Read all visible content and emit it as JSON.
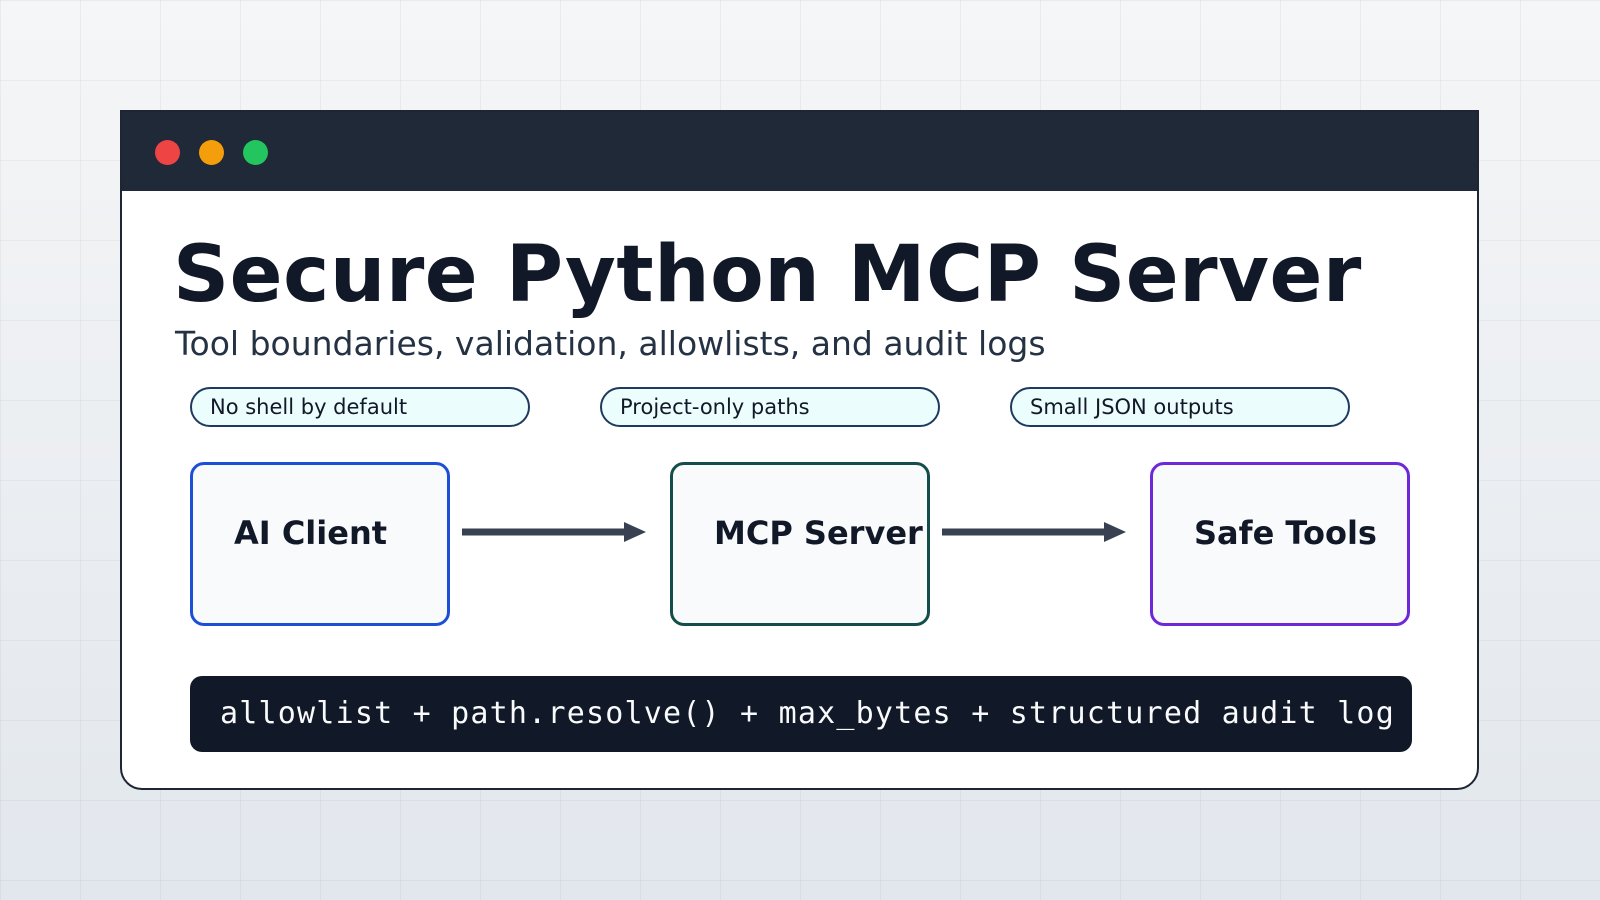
{
  "window": {
    "controls": [
      "close-dot",
      "minimize-dot",
      "maximize-dot"
    ],
    "colors": {
      "close": "#ef4444",
      "minimize": "#f59e0b",
      "maximize": "#22c55e",
      "titlebar": "#1f2937"
    }
  },
  "header": {
    "title": "Secure Python MCP Server",
    "subtitle": "Tool boundaries, validation, allowlists, and audit logs"
  },
  "pills": [
    {
      "label": "No shell by default"
    },
    {
      "label": "Project-only paths"
    },
    {
      "label": "Small JSON outputs"
    }
  ],
  "flow": {
    "nodes": [
      {
        "label": "AI Client",
        "color": "#1d4ed8"
      },
      {
        "label": "MCP Server",
        "color": "#134e4a"
      },
      {
        "label": "Safe Tools",
        "color": "#6d28d9"
      }
    ],
    "arrow_color": "#374151"
  },
  "code": {
    "text": "allowlist + path.resolve() + max_bytes + structured audit log"
  }
}
